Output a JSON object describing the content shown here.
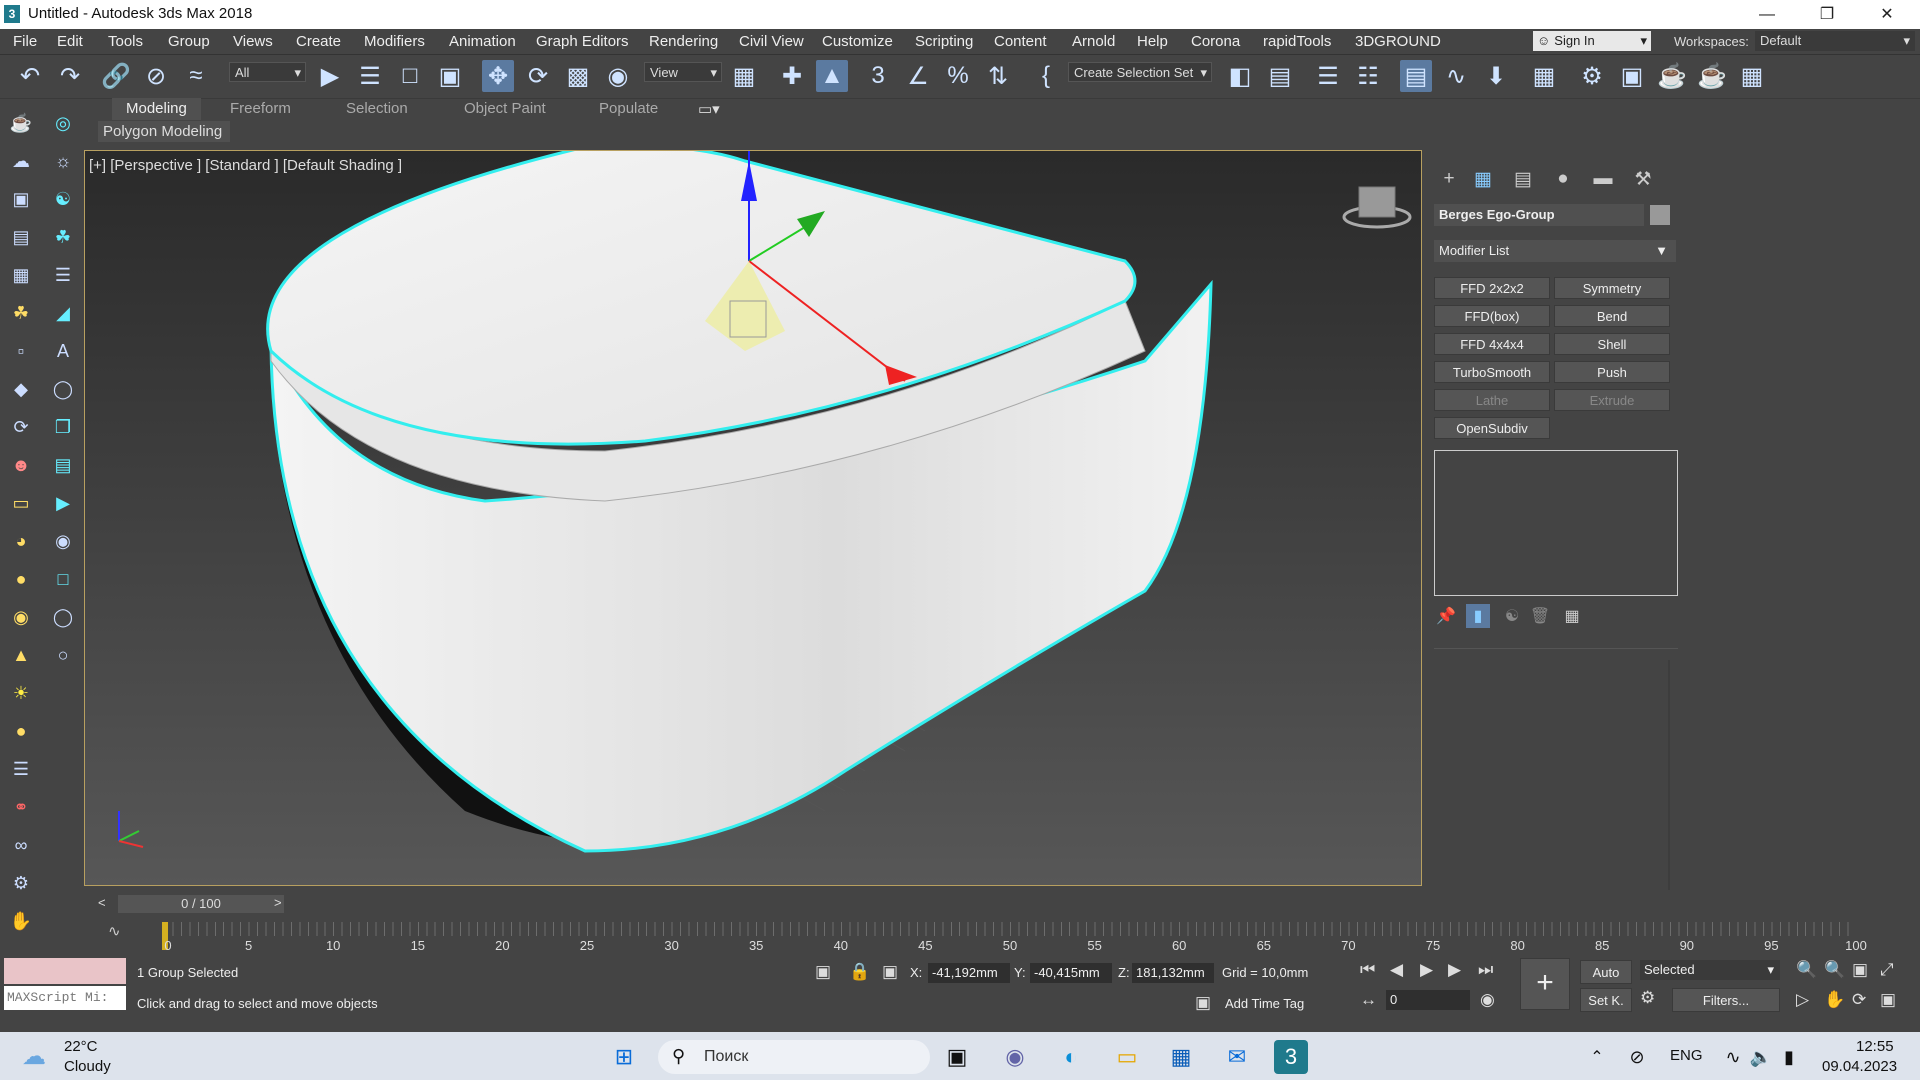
{
  "window": {
    "title": "Untitled - Autodesk 3ds Max 2018",
    "app_icon": "3"
  },
  "menubar": [
    "File",
    "Edit",
    "Tools",
    "Group",
    "Views",
    "Create",
    "Modifiers",
    "Animation",
    "Graph Editors",
    "Rendering",
    "Civil View",
    "Customize",
    "Scripting",
    "Content",
    "Arnold",
    "Help",
    "Corona",
    "rapidTools",
    "3DGROUND"
  ],
  "signin": {
    "label": "Sign In"
  },
  "workspaces": {
    "label": "Workspaces:",
    "value": "Default"
  },
  "toolbar": {
    "filter_value": "All",
    "refcoord_value": "View",
    "selection_set_placeholder": "Create Selection Set"
  },
  "ribbon": {
    "tabs": [
      "Modeling",
      "Freeform",
      "Selection",
      "Object Paint",
      "Populate"
    ],
    "active_tab": "Modeling",
    "subtitle": "Polygon Modeling"
  },
  "viewport": {
    "label": "[+] [Perspective ] [Standard ] [Default Shading ]"
  },
  "command_panel": {
    "object_name": "Berges Ego-Group",
    "modifier_list": "Modifier List",
    "modifiers": [
      "FFD 2x2x2",
      "Symmetry",
      "FFD(box)",
      "Bend",
      "FFD 4x4x4",
      "Shell",
      "TurboSmooth",
      "Push",
      "Lathe",
      "Extrude",
      "OpenSubdiv"
    ]
  },
  "time_slider": {
    "value": "0 / 100",
    "prev": "<",
    "next": ">"
  },
  "trackbar": {
    "ticks": [
      "0",
      "5",
      "10",
      "15",
      "20",
      "25",
      "30",
      "35",
      "40",
      "45",
      "50",
      "55",
      "60",
      "65",
      "70",
      "75",
      "80",
      "85",
      "90",
      "95",
      "100"
    ]
  },
  "status": {
    "maxscript": "MAXScript Mi:",
    "selected": "1 Group Selected",
    "prompt": "Click and drag to select and move objects",
    "x_label": "X:",
    "x": "-41,192mm",
    "y_label": "Y:",
    "y": "-40,415mm",
    "z_label": "Z:",
    "z": "181,132mm",
    "grid": "Grid = 10,0mm",
    "add_time_tag": "Add Time Tag",
    "auto_key": "Auto",
    "set_key": "Set K.",
    "key_filter": "Selected",
    "filters": "Filters...",
    "frame": "0"
  },
  "taskbar": {
    "weather_temp": "22°C",
    "weather_desc": "Cloudy",
    "search": "Поиск",
    "lang": "ENG",
    "time": "12:55",
    "date": "09.04.2023"
  }
}
